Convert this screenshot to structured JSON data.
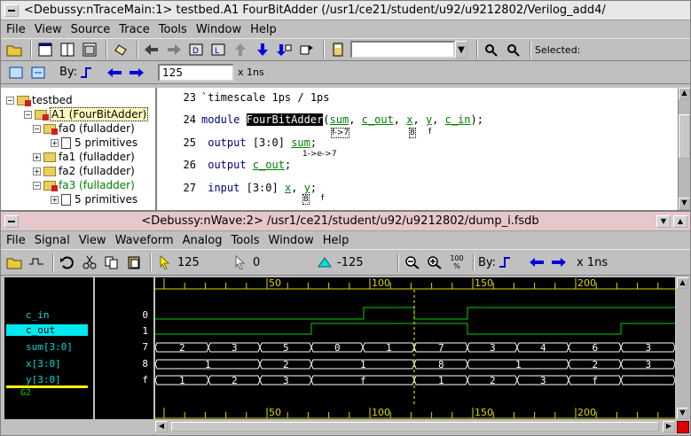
{
  "trace_window": {
    "title": "<Debussy:nTraceMain:1> testbed.A1 FourBitAdder (/usr1/ce21/student/u92/u9212802/Verilog_add4/",
    "menu": [
      "File",
      "View",
      "Source",
      "Trace",
      "Tools",
      "Window",
      "Help"
    ],
    "selected_label": "Selected:",
    "by_label": "By:",
    "delay_value": "125",
    "delay_unit": "x 1ns",
    "hierarchy": [
      {
        "label": "testbed",
        "indent": 0
      },
      {
        "label": "A1 (FourBitAdder)",
        "indent": 1
      },
      {
        "label": "fa0 (fulladder)",
        "indent": 2
      },
      {
        "label": "5 primitives",
        "indent": 3
      },
      {
        "label": "fa1 (fulladder)",
        "indent": 2
      },
      {
        "label": "fa2 (fulladder)",
        "indent": 2
      },
      {
        "label": "fa3 (fulladder)",
        "indent": 2
      },
      {
        "label": "5 primitives",
        "indent": 3
      }
    ],
    "source": {
      "l23_num": "23",
      "l23": "`timescale 1ps / 1ps",
      "l24_num": "24",
      "l24_kw": "module",
      "l24_name": "FourBitAdder",
      "l24_args_sum": "sum",
      "l24_args_cout": "c_out",
      "l24_args_x": "x",
      "l24_args_y": "y",
      "l24_args_cin": "c_in",
      "l25_num": "25",
      "l25_kw": "output",
      "l25_range": "[3:0]",
      "l25_sig": "sum",
      "l26_num": "26",
      "l26_kw": "output",
      "l26_sig": "c_out",
      "l27_num": "27",
      "l27_kw": "input",
      "l27_range": "[3:0]",
      "l27_sig_x": "x",
      "l27_sig_y": "y",
      "anno_24": "f->7",
      "anno_24b": "8",
      "anno_24c": "f",
      "anno_25": "1->e->7",
      "anno_27": "8",
      "anno_27b": "f"
    }
  },
  "wave_window": {
    "title": "<Debussy:nWave:2> /usr1/ce21/student/u92/u9212802/dump_i.fsdb",
    "menu": [
      "File",
      "Signal",
      "View",
      "Waveform",
      "Analog",
      "Tools",
      "Window",
      "Help"
    ],
    "cursor_time": "125",
    "marker_time": "0",
    "delta_time": "-125",
    "zoom_label": "100",
    "zoom_sub": "%",
    "by_label": "By:",
    "unit": "x 1ns",
    "ruler_ticks": [
      "50",
      "100",
      "150",
      "200"
    ],
    "signals": [
      {
        "name": "c_in",
        "value": "0"
      },
      {
        "name": "c_out",
        "value": "1"
      },
      {
        "name": "sum[3:0]",
        "value": "7"
      },
      {
        "name": "x[3:0]",
        "value": "8"
      },
      {
        "name": "y[3:0]",
        "value": "f"
      }
    ],
    "group_label": "G2",
    "sum_values": [
      "2",
      "3",
      "5",
      "0",
      "1",
      "7",
      "3",
      "4",
      "6",
      "3"
    ],
    "x_values": [
      "1",
      "2",
      "1",
      "8",
      "1",
      "2",
      "3"
    ],
    "y_values": [
      "1",
      "2",
      "3",
      "f",
      "1",
      "2",
      "3",
      "f"
    ],
    "colors": {
      "wave_bg": "#000000",
      "trace_green": "#00d000",
      "bus_white": "#ffffff",
      "ruler_yellow": "#d8d800",
      "signal_cyan": "#00d8d8",
      "cursor_yellow": "#ffff00"
    }
  }
}
